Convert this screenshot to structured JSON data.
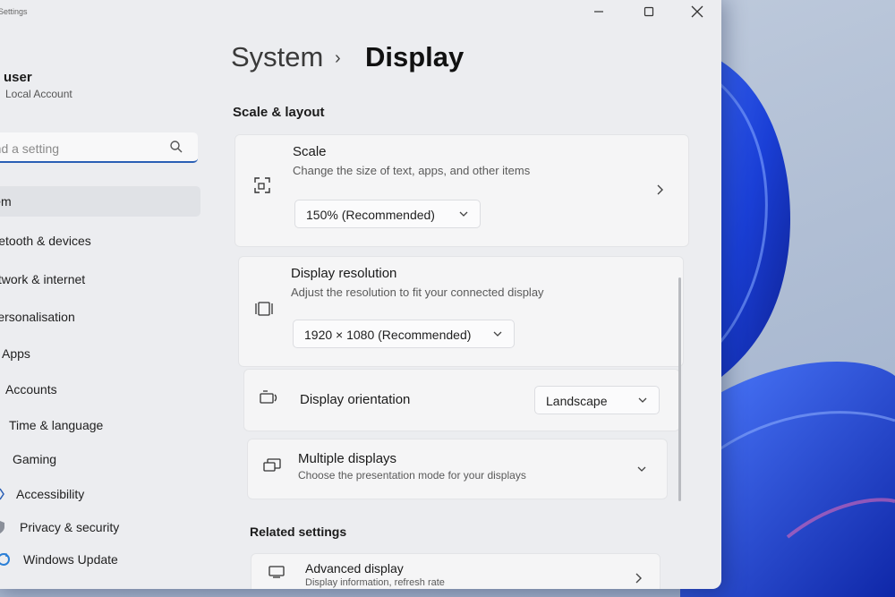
{
  "window": {
    "title": "Settings",
    "controls": [
      "minimize",
      "maximize",
      "close"
    ]
  },
  "user": {
    "name": "user",
    "account_type": "Local Account"
  },
  "search": {
    "placeholder": "Find a setting"
  },
  "sidebar": {
    "items": [
      {
        "label": "System",
        "icon": "system-icon",
        "active": true
      },
      {
        "label": "Bluetooth & devices",
        "icon": "bluetooth-icon"
      },
      {
        "label": "Network & internet",
        "icon": "wifi-icon"
      },
      {
        "label": "Personalisation",
        "icon": "brush-icon"
      },
      {
        "label": "Apps",
        "icon": "apps-icon"
      },
      {
        "label": "Accounts",
        "icon": "person-icon"
      },
      {
        "label": "Time & language",
        "icon": "clock-icon"
      },
      {
        "label": "Gaming",
        "icon": "gamepad-icon"
      },
      {
        "label": "Accessibility",
        "icon": "accessibility-icon"
      },
      {
        "label": "Privacy & security",
        "icon": "shield-icon"
      },
      {
        "label": "Windows Update",
        "icon": "update-icon"
      }
    ]
  },
  "breadcrumb": {
    "parent": "System",
    "separator": "›",
    "current": "Display"
  },
  "scale_layout": {
    "heading": "Scale & layout",
    "scale": {
      "title": "Scale",
      "description": "Change the size of text, apps, and other items",
      "value": "150% (Recommended)"
    },
    "resolution": {
      "title": "Display resolution",
      "description": "Adjust the resolution to fit your connected display",
      "value": "1920 × 1080 (Recommended)"
    },
    "orientation": {
      "title": "Display orientation",
      "value": "Landscape"
    },
    "multiple": {
      "title": "Multiple displays",
      "description": "Choose the presentation mode for your displays"
    }
  },
  "related": {
    "heading": "Related settings",
    "advanced": {
      "title": "Advanced display",
      "description": "Display information, refresh rate"
    }
  },
  "colors": {
    "accent": "#2a5fb5",
    "window_bg": "#ecedf0",
    "card_bg": "#f5f5f6",
    "wallpaper_blue": "#1d3fd0"
  }
}
